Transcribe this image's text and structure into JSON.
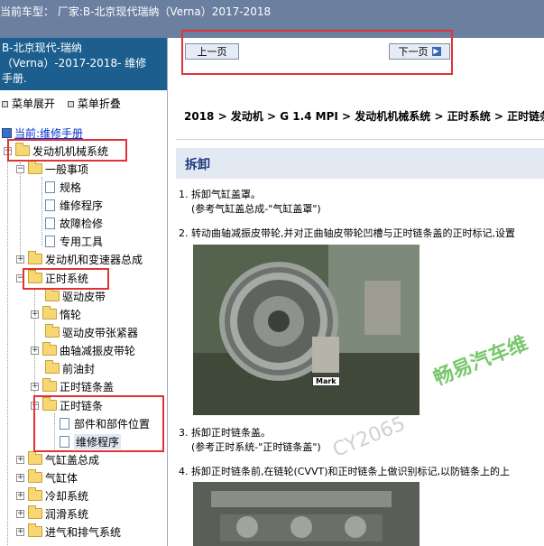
{
  "window": {
    "title": "当前车型： 厂家:B-北京现代瑞纳（Verna）2017-2018"
  },
  "sidebar": {
    "header_line1": "B-北京现代-瑞纳",
    "header_line2": "（Verna）-2017-2018- 维修",
    "header_line3": "手册.",
    "expand_label": "菜单展开",
    "collapse_label": "菜单折叠",
    "root_label": "当前:维修手册",
    "tree": {
      "engine_mech": "发动机机械系统",
      "general": "一般事项",
      "spec": "规格",
      "repair_proc": "维修程序",
      "diagnosis": "故障检修",
      "special_tools": "专用工具",
      "engine_trans": "发动机和变速器总成",
      "timing_system": "正时系统",
      "drive_belt": "驱动皮带",
      "idler": "惰轮",
      "belt_tensioner": "驱动皮带张紧器",
      "crank_pulley": "曲轴减振皮带轮",
      "front_oil_seal": "前油封",
      "timing_cover": "正时链条盖",
      "timing_chain": "正时链条",
      "components": "部件和部件位置",
      "chain_repair": "维修程序",
      "head_assy": "气缸盖总成",
      "block": "气缸体",
      "cooling": "冷却系统",
      "lubrication": "润滑系统",
      "intake_exhaust": "进气和排气系统"
    }
  },
  "nav": {
    "prev_label": "上一页",
    "next_label": "下一页"
  },
  "content": {
    "breadcrumb": "2018 > 发动机 > G 1.4 MPI > 发动机机械系统 > 正时系统 > 正时链条",
    "section_title": "拆卸",
    "step1_line1": "1. 拆卸气缸盖罩。",
    "step1_line2": "(参考气缸盖总成-\"气缸盖罩\")",
    "step2_line1": "2. 转动曲轴减振皮带轮,并对正曲轴皮带轮凹槽与正时链条盖的正时标记,设置",
    "mark_label": "Mark",
    "step3_line1": "3. 拆卸正时链条盖。",
    "step3_line2": "(参考正时系统-\"正时链条盖\")",
    "step4_line1": "4. 拆卸正时链条前,在链轮(CVVT)和正时链条上做识别标记,以防链条上的上",
    "watermark_main": "畅易汽车维",
    "watermark_sub": "CY2065"
  },
  "colors": {
    "topbar_bg": "#6b7fa0",
    "sidebar_header_bg": "#1c5f8f",
    "highlight_red": "#e23237",
    "section_title_bg": "#e3e9f3",
    "watermark_green": "#4cb43c"
  }
}
